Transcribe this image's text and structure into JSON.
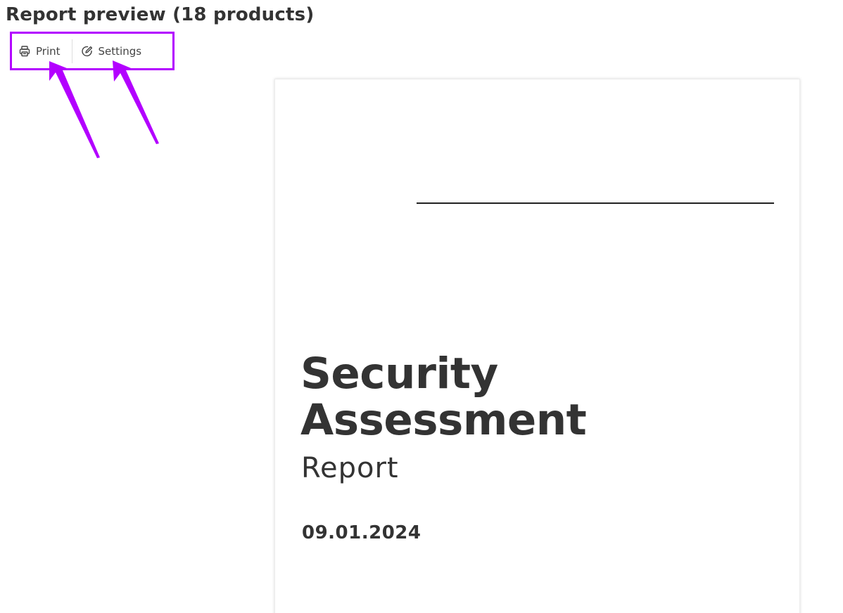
{
  "header": {
    "title": "Report preview (18 products)"
  },
  "toolbar": {
    "print_label": "Print",
    "settings_label": "Settings",
    "print_icon": "printer-icon",
    "settings_icon": "edit-settings-icon",
    "highlight_color": "#b300ff"
  },
  "report": {
    "title_line1": "Security",
    "title_line2": "Assessment",
    "subtitle": "Report",
    "date": "09.01.2024"
  },
  "colors": {
    "text": "#333333",
    "annotation": "#b300ff"
  }
}
